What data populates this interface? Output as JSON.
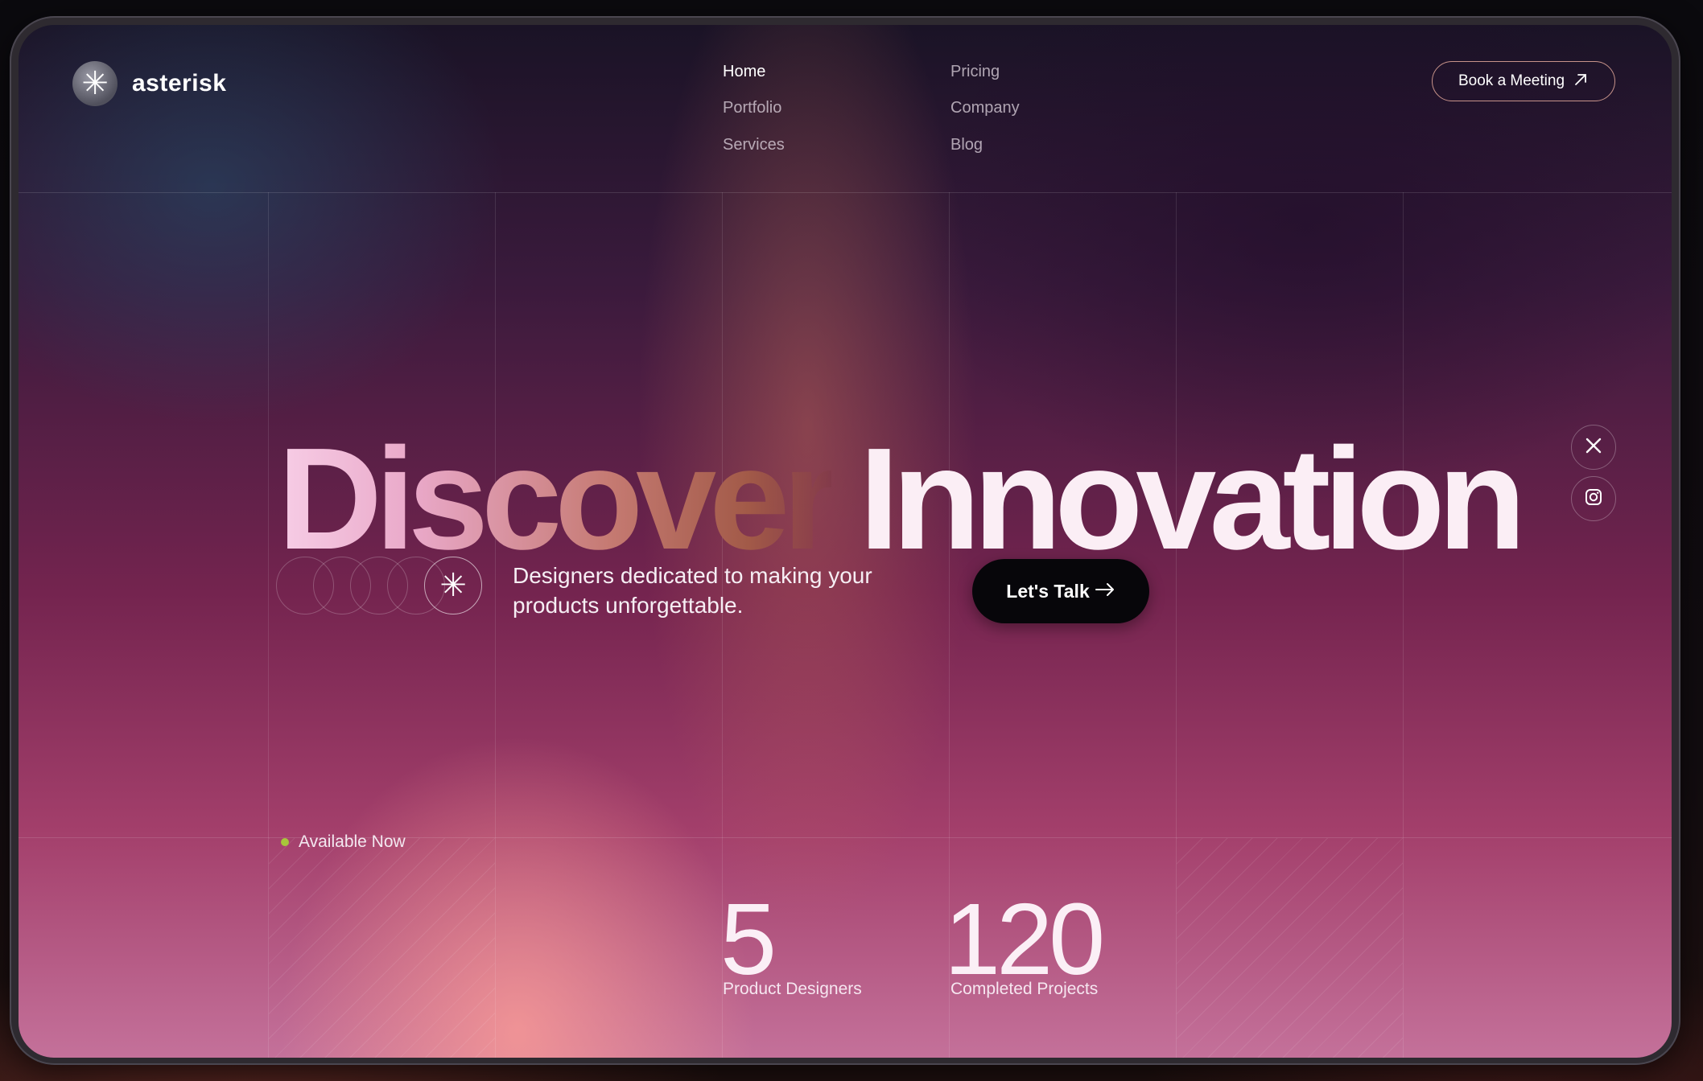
{
  "brand": {
    "name": "asterisk",
    "logo_icon": "asterisk-icon"
  },
  "nav": {
    "items": [
      {
        "label": "Home",
        "active": true
      },
      {
        "label": "Portfolio",
        "active": false
      },
      {
        "label": "Services",
        "active": false
      },
      {
        "label": "Pricing",
        "active": false
      },
      {
        "label": "Company",
        "active": false
      },
      {
        "label": "Blog",
        "active": false
      }
    ]
  },
  "header": {
    "cta_label": "Book a Meeting",
    "cta_icon": "arrow-up-right-icon"
  },
  "hero": {
    "title_word_1": "Discover",
    "title_word_2": "Innovation",
    "tagline": "Designers dedicated to making your products unforgettable.",
    "cta_label": "Let's Talk",
    "cta_icon": "arrow-right-icon"
  },
  "social": [
    {
      "icon": "x-icon"
    },
    {
      "icon": "instagram-icon"
    }
  ],
  "status": {
    "label": "Available Now",
    "dot_color": "#a8c63a"
  },
  "stats": [
    {
      "value": "5",
      "label": "Product Designers"
    },
    {
      "value": "120",
      "label": "Completed Projects"
    }
  ],
  "colors": {
    "accent_dark": "#07060a",
    "text_light": "#fbeef5"
  }
}
